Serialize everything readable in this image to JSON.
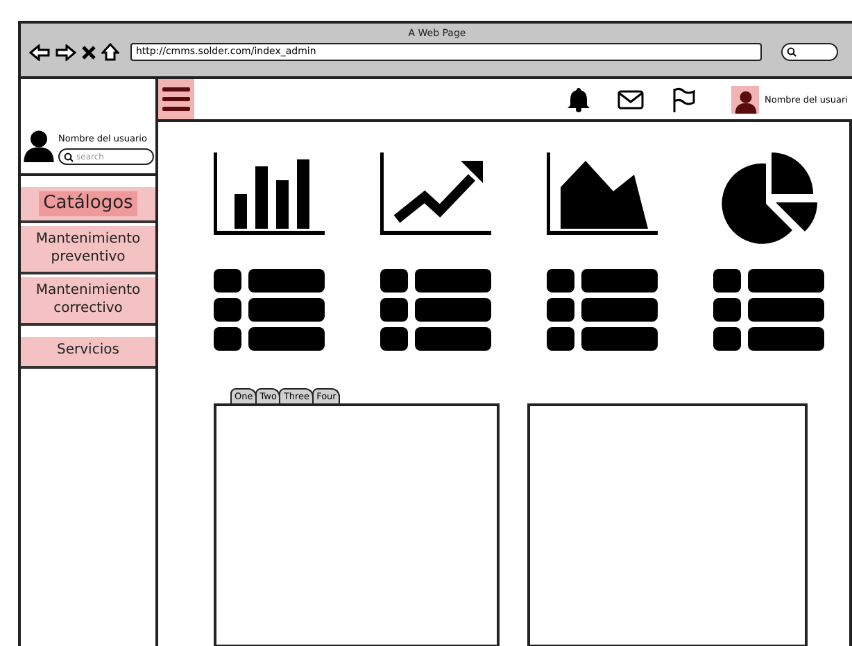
{
  "window": {
    "title": "A Web Page",
    "url": "http://cmms.solder.com/index_admin"
  },
  "header": {
    "user_name": "Nombre del usuari"
  },
  "sidebar": {
    "user_name": "Nombre del usuario",
    "search": {
      "placeholder": "search"
    },
    "items": [
      {
        "label": "Catálogos",
        "selected": true
      },
      {
        "label": "Mantenimiento preventivo",
        "selected": false
      },
      {
        "label": "Mantenimiento correctivo",
        "selected": false
      },
      {
        "label": "Servicios",
        "selected": false
      }
    ]
  },
  "tabs": [
    "One",
    "Two",
    "Three",
    "Four"
  ]
}
